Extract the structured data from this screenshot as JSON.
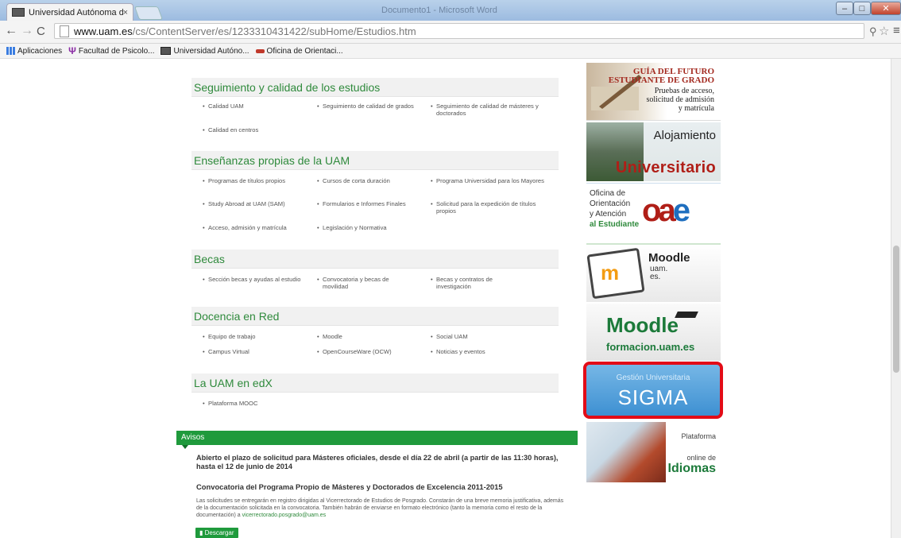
{
  "window": {
    "tab_title": "Universidad Autónoma de",
    "tab_close": "×",
    "title": "Documento1 - Microsoft Word",
    "min": "–",
    "max": "□",
    "close": "✕"
  },
  "address": {
    "host": "www.uam.es",
    "path": "/cs/ContentServer/es/1233310431422/subHome/Estudios.htm"
  },
  "bookmarks": [
    {
      "label": "Aplicaciones"
    },
    {
      "label": "Facultad de Psicolo..."
    },
    {
      "label": "Universidad Autóno..."
    },
    {
      "label": "Oficina de Orientaci..."
    }
  ],
  "sections": [
    {
      "title": "Seguimiento y calidad de los estudios",
      "items": [
        "Calidad UAM",
        "Seguimiento de calidad de grados",
        "Seguimiento de calidad de másteres y doctorados",
        "Calidad en centros"
      ]
    },
    {
      "title": "Enseñanzas propias de la UAM",
      "items": [
        "Programas de títulos propios",
        "Cursos de corta duración",
        "Programa Universidad para los Mayores",
        "Study Abroad at UAM (SAM)",
        "Formularios e Informes Finales",
        "Solicitud para la expedición de títulos propios",
        "Acceso, admisión y matrícula",
        "Legislación y Normativa"
      ]
    },
    {
      "title": "Becas",
      "items": [
        "Sección becas y ayudas al estudio",
        "Convocatoria y becas de movilidad",
        "Becas y contratos de investigación"
      ]
    },
    {
      "title": "Docencia en Red",
      "items": [
        "Equipo de trabajo",
        "Moodle",
        "Social UAM",
        "Campus Virtual",
        "OpenCourseWare (OCW)",
        "Noticias y eventos"
      ]
    },
    {
      "title": "La UAM en edX",
      "items": [
        "Plataforma MOOC"
      ]
    }
  ],
  "avisos": {
    "heading": "Avisos",
    "aviso1": "Abierto el plazo de solicitud para Másteres oficiales, desde el día 22 de abril (a partir de las 11:30 horas), hasta el 12 de junio de 2014",
    "aviso2_title": "Convocatoria del Programa Propio de Másteres y Doctorados de Excelencia 2011-2015",
    "aviso2_body": "Las solicitudes se entregarán en registro dirigidas al Vicerrectorado de Estudios de Posgrado. Constarán de una breve memoria justificativa, además de la documentación solicitada en la convocatoria. También habrán de enviarse en formato electrónico (tanto la memoria como el resto de la documentación) a",
    "aviso2_email": "vicerrectorado.posgrado@uam.es",
    "download": "Descargar"
  },
  "banners": {
    "guia_title_1": "GUÍA DEL FUTURO",
    "guia_title_2": "ESTUDIANTE DE GRADO",
    "guia_sub_1": "Pruebas de acceso,",
    "guia_sub_2": "solicitud de admisión",
    "guia_sub_3": "y matrícula",
    "aloj_1": "Alojamiento",
    "aloj_2": "Universitario",
    "oae_1": "Oficina de",
    "oae_2": "Orientación",
    "oae_3": "y Atención",
    "oae_4": "al Estudiante",
    "oae_logo_o": "o",
    "oae_logo_a": "a",
    "oae_logo_e": "e",
    "moodle1_title": "Moodle",
    "moodle1_sub_1": "uam.",
    "moodle1_sub_2": "es.",
    "moodle2_title": "Moodle",
    "moodle2_sub": "formacion.uam.es",
    "sigma_1": "Gestión Universitaria",
    "sigma_2": "SIGMA",
    "idiomas_1": "Plataforma",
    "idiomas_2": "online de",
    "idiomas_3": "Idiomas"
  }
}
